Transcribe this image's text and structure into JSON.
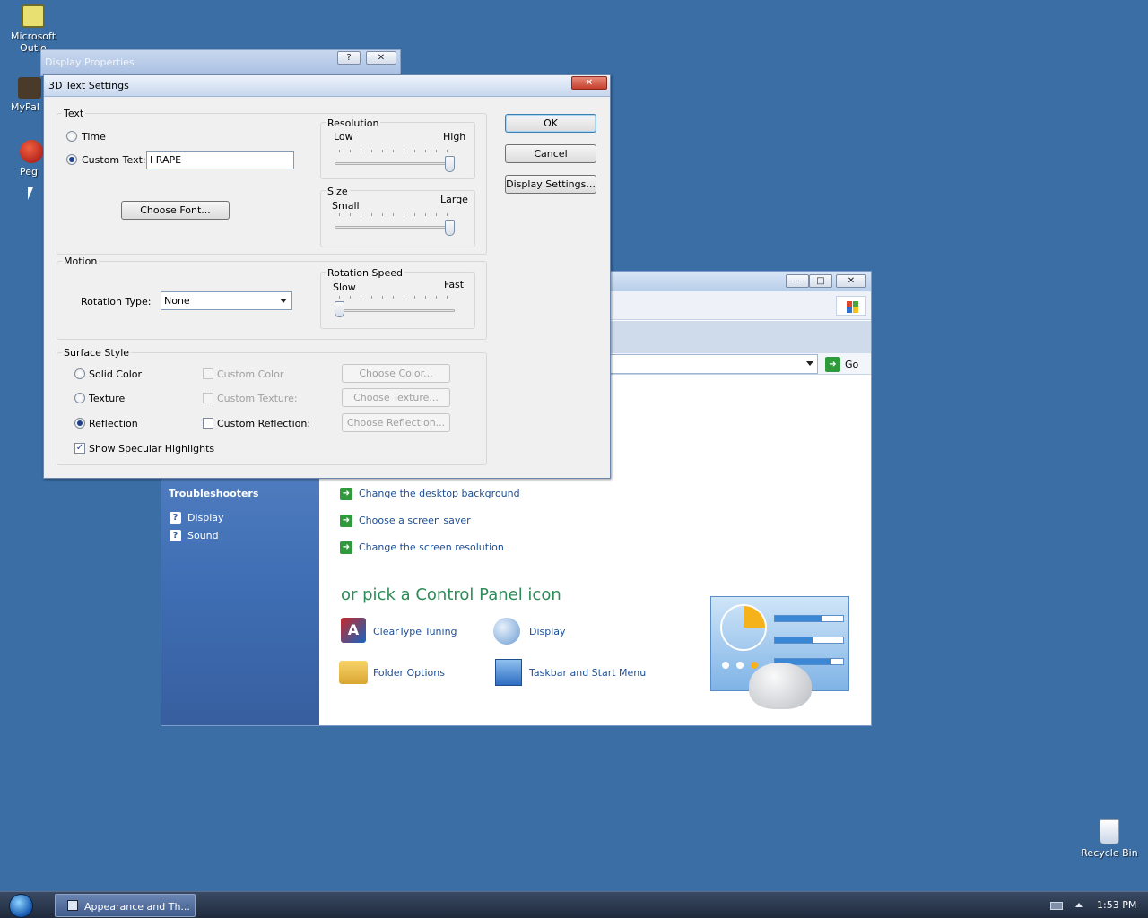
{
  "desktop": {
    "icons": [
      {
        "label": "Microsoft Outlo"
      },
      {
        "label": "MyPal"
      },
      {
        "label": "Peg"
      },
      {
        "label": "Recycle Bin"
      }
    ]
  },
  "behind_dialog": {
    "title": "Display Properties"
  },
  "dialog": {
    "title": "3D Text Settings",
    "text_group": {
      "label": "Text",
      "time": "Time",
      "custom_text": "Custom Text:",
      "custom_value": "I RAPE",
      "choose_font": "Choose Font..."
    },
    "resolution": {
      "label": "Resolution",
      "low": "Low",
      "high": "High",
      "level": 1.0
    },
    "size": {
      "label": "Size",
      "small": "Small",
      "large": "Large",
      "level": 1.0
    },
    "motion": {
      "label": "Motion",
      "rotation_type_label": "Rotation Type:",
      "rotation_type_value": "None"
    },
    "rotation_speed": {
      "label": "Rotation Speed",
      "slow": "Slow",
      "fast": "Fast",
      "level": 0.0
    },
    "surface": {
      "label": "Surface Style",
      "solid_color": "Solid Color",
      "texture": "Texture",
      "reflection": "Reflection",
      "custom_color": "Custom Color",
      "custom_texture": "Custom Texture:",
      "custom_reflection": "Custom Reflection:",
      "choose_color": "Choose Color...",
      "choose_texture": "Choose Texture...",
      "choose_reflection": "Choose Reflection...",
      "specular": "Show Specular Highlights"
    },
    "buttons": {
      "ok": "OK",
      "cancel": "Cancel",
      "display_settings": "Display Settings..."
    }
  },
  "control_panel": {
    "go": "Go",
    "troubleshooters": "Troubleshooters",
    "side_links": [
      "Display",
      "Sound"
    ],
    "tasks": [
      "Change the desktop background",
      "Choose a screen saver",
      "Change the screen resolution"
    ],
    "pick_heading": "or pick a Control Panel icon",
    "icons": [
      "ClearType Tuning",
      "Display",
      "Folder Options",
      "Taskbar and Start Menu"
    ]
  },
  "taskbar": {
    "window_button": "Appearance and Th...",
    "clock": "1:53 PM"
  },
  "colors": {
    "desktop": "#3a6ea5",
    "link": "#1c4f96",
    "heading_green": "#2e8b57",
    "sidebar": "#4a79bf"
  }
}
